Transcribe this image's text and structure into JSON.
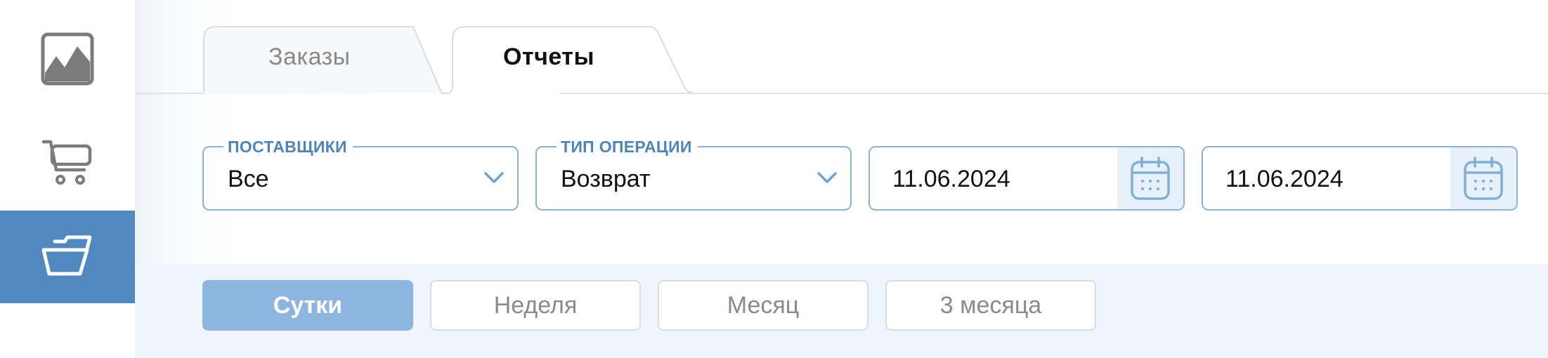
{
  "sidebar": {
    "items": [
      {
        "name": "chart-icon",
        "active": false
      },
      {
        "name": "cart-icon",
        "active": false
      },
      {
        "name": "folder-icon",
        "active": true
      }
    ],
    "active_color": "#5089bf"
  },
  "tabs": [
    {
      "label": "Заказы",
      "active": false
    },
    {
      "label": "Отчеты",
      "active": true
    }
  ],
  "filters": {
    "supplier": {
      "label": "ПОСТАВЩИКИ",
      "value": "Все"
    },
    "operation_type": {
      "label": "ТИП ОПЕРАЦИИ",
      "value": "Возврат"
    },
    "date_from": {
      "value": "11.06.2024"
    },
    "date_to": {
      "value": "11.06.2024"
    }
  },
  "periods": [
    {
      "label": "Сутки",
      "active": true
    },
    {
      "label": "Неделя",
      "active": false
    },
    {
      "label": "Месяц",
      "active": false
    },
    {
      "label": "3 месяца",
      "active": false
    }
  ],
  "colors": {
    "accent": "#4b85bd",
    "field_border": "#8ab3da",
    "active_period": "#8cb6e0"
  }
}
